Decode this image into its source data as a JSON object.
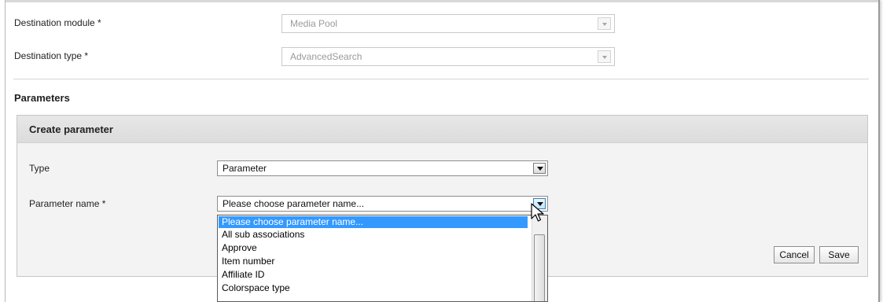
{
  "destination": {
    "module_label": "Destination module *",
    "module_value": "Media Pool",
    "type_label": "Destination type *",
    "type_value": "AdvancedSearch"
  },
  "parameters": {
    "section_title": "Parameters",
    "create_panel": {
      "title": "Create parameter",
      "type_label": "Type",
      "type_value": "Parameter",
      "param_name_label": "Parameter name *",
      "param_name_value": "Please choose parameter name...",
      "dropdown_options": [
        "Please choose parameter name...",
        "All sub associations",
        "Approve",
        "Item number",
        "Affiliate ID",
        "Colorspace type"
      ],
      "cancel_label": "Cancel",
      "save_label": "Save"
    }
  },
  "colors": {
    "selection": "#3399ff",
    "panel_bg": "#f3f3f3"
  },
  "icons": {
    "select_arrow": "chevron-down-icon",
    "cursor": "mouse-pointer-icon"
  }
}
